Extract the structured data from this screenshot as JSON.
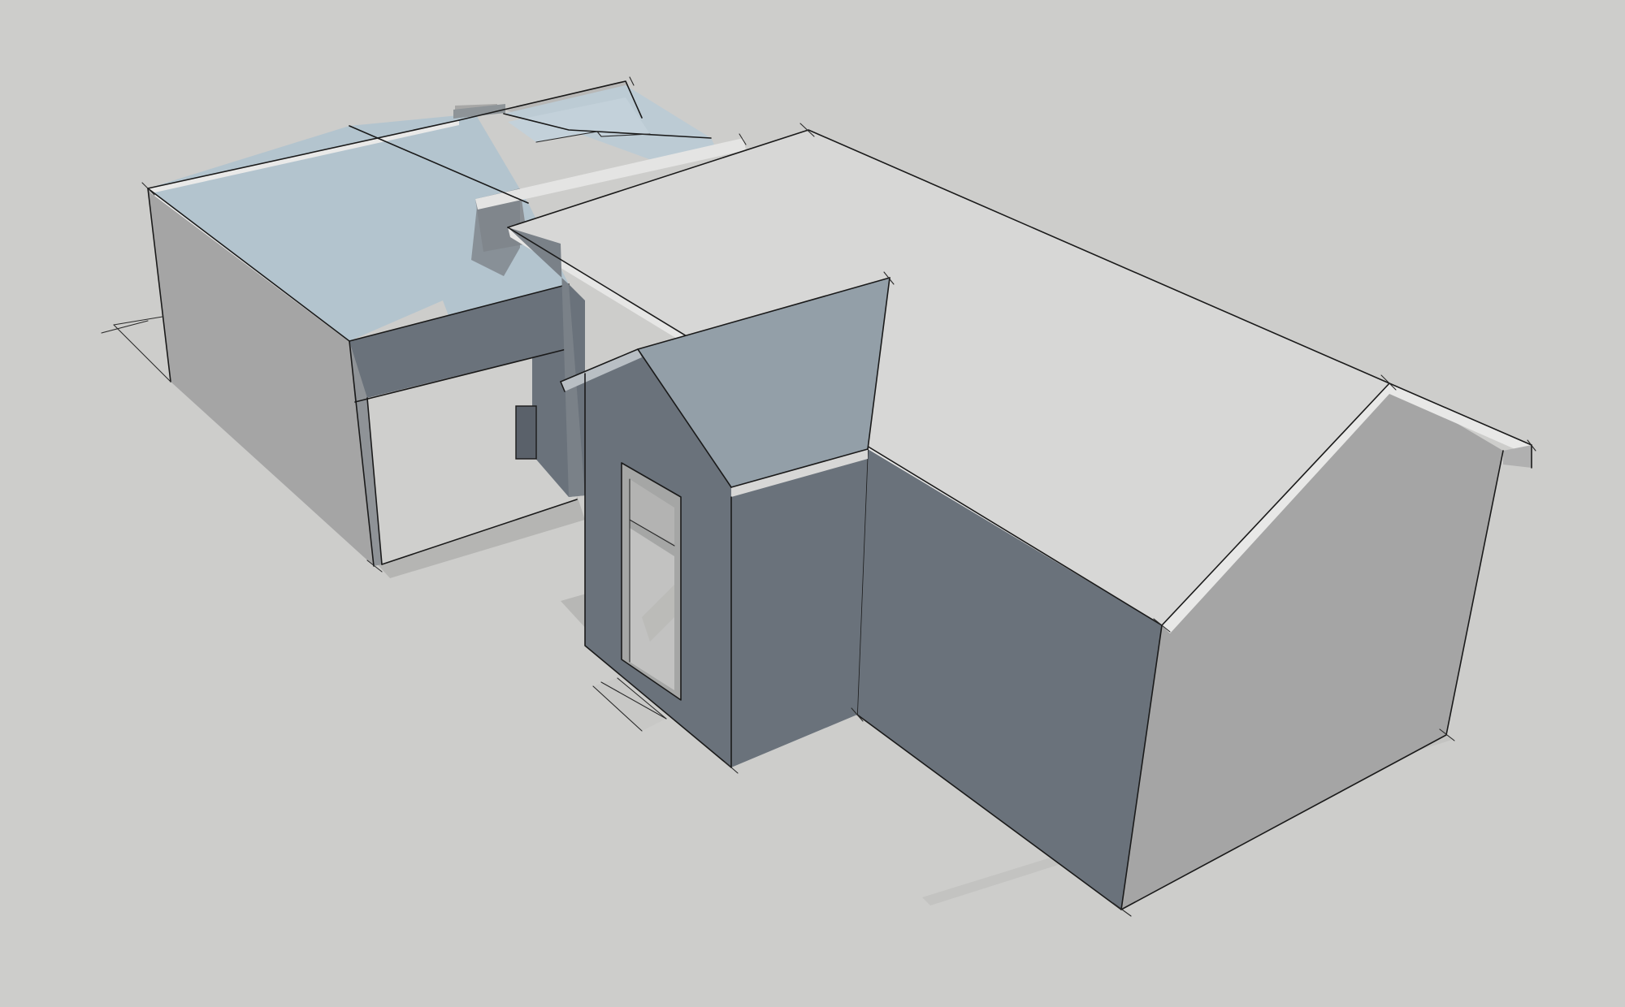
{
  "scene": {
    "background_color": "#cdcdcb",
    "style": "sketchy-edges",
    "colors": {
      "roof_light": "#d7d7d6",
      "glass_roof": "#b3c4ce",
      "wall_dark": "#6a727b",
      "wall_mid": "#a4a4a4",
      "gable_blue": "#939fa8",
      "shadow": "#a9a9a7"
    }
  }
}
